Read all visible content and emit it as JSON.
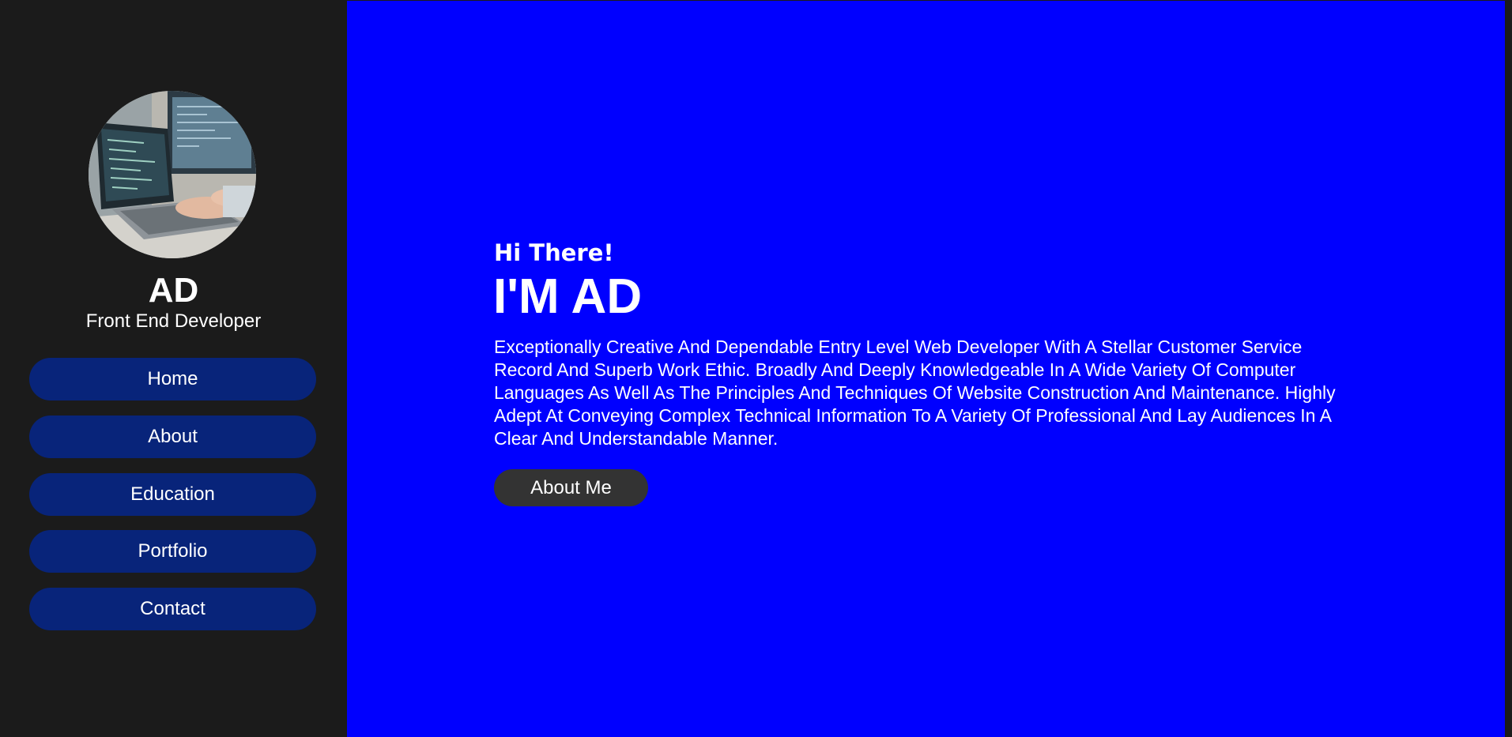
{
  "sidebar": {
    "profile_name": "AD",
    "profile_role": "Front End Developer",
    "nav": [
      {
        "label": "Home"
      },
      {
        "label": "About"
      },
      {
        "label": "Education"
      },
      {
        "label": "Portfolio"
      },
      {
        "label": "Contact"
      }
    ]
  },
  "hero": {
    "greeting": "Hi There!",
    "headline": "I'M AD",
    "description": "Exceptionally Creative And Dependable Entry Level Web Developer With A Stellar Customer Service Record And Superb Work Ethic. Broadly And Deeply Knowledgeable In A Wide Variety Of Computer Languages As Well As The Principles And Techniques Of Website Construction And Maintenance. Highly Adept At Conveying Complex Technical Information To A Variety Of Professional And Lay Audiences In A Clear And Understandable Manner.",
    "button_label": "About Me"
  },
  "colors": {
    "sidebar_bg": "#1b1b1b",
    "main_bg": "#0000ff",
    "nav_button_bg": "#08247a",
    "cta_button_bg": "#333333",
    "text": "#ffffff"
  }
}
